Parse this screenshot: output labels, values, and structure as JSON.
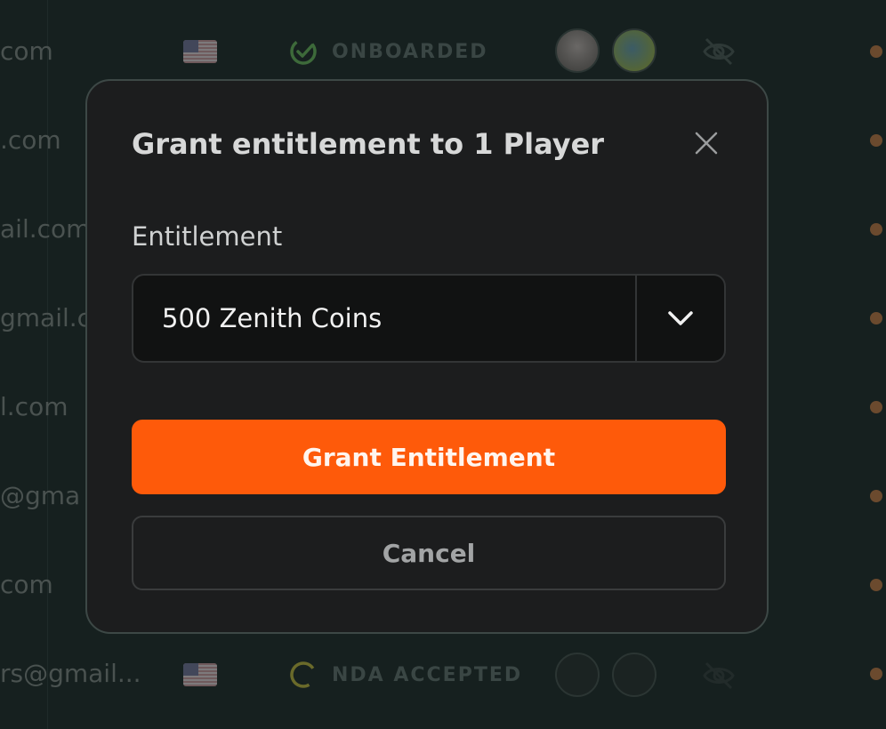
{
  "background": {
    "rows": [
      {
        "email": "com"
      },
      {
        "email": ".com"
      },
      {
        "email": "ail.com"
      },
      {
        "email": "gmail.co"
      },
      {
        "email": "l.com"
      },
      {
        "email": "@gma"
      },
      {
        "email": "com"
      },
      {
        "email": "rs@gmail..."
      }
    ],
    "status_onboarded": "ONBOARDED",
    "status_nda": "NDA ACCEPTED",
    "colors": {
      "onboarded_icon": "#3d6a3a",
      "nda_icon": "#6a6a2a",
      "dot": "#6b4a2e"
    }
  },
  "modal": {
    "title": "Grant entitlement to 1 Player",
    "field_label": "Entitlement",
    "selected_value": "500 Zenith Coins",
    "primary_button": "Grant Entitlement",
    "secondary_button": "Cancel",
    "colors": {
      "accent": "#fe5a0a"
    }
  }
}
